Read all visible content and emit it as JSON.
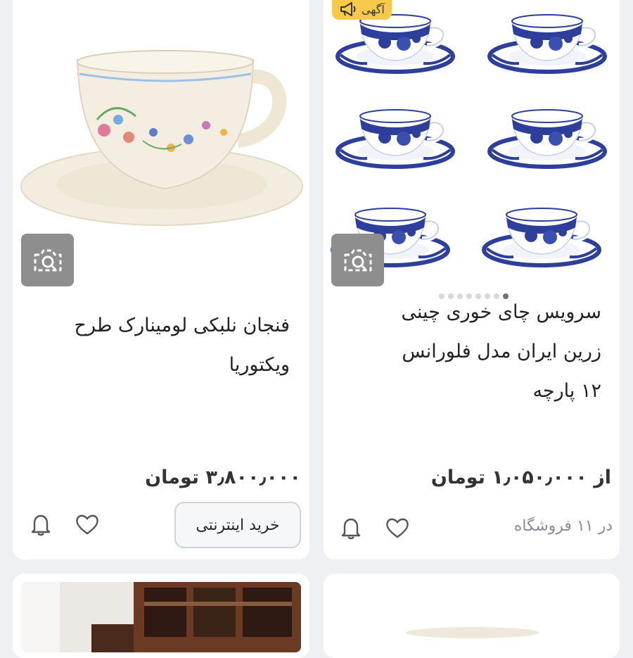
{
  "products": [
    {
      "title_line1": "فنجان نلبکی لومینارک طرح",
      "title_line2": "ویکتوریا",
      "price": "۳٫۸۰۰٫۰۰۰ تومان",
      "buy_label": "خرید اینترنتی"
    },
    {
      "ad_label": "آگهی",
      "title_line1": "سرویس چای خوری چینی",
      "title_line2": "زرین ایران مدل فلورانس",
      "title_line3": "۱۲ پارچه",
      "price": "از ۱٫۰۵۰٫۰۰۰ تومان",
      "store_count": "در ۱۱ فروشگاه",
      "image_count": 8,
      "active_image": 1
    }
  ],
  "icons": {
    "visual_search": "camera-search-icon",
    "favorite": "heart-icon",
    "notify": "bell-icon",
    "ad": "megaphone-icon"
  },
  "colors": {
    "ad_badge": "#f7c948",
    "visual_search_bg": "#8e8e8e",
    "background": "#eef0f3",
    "porcelain_blue": "#2d3f9a"
  }
}
